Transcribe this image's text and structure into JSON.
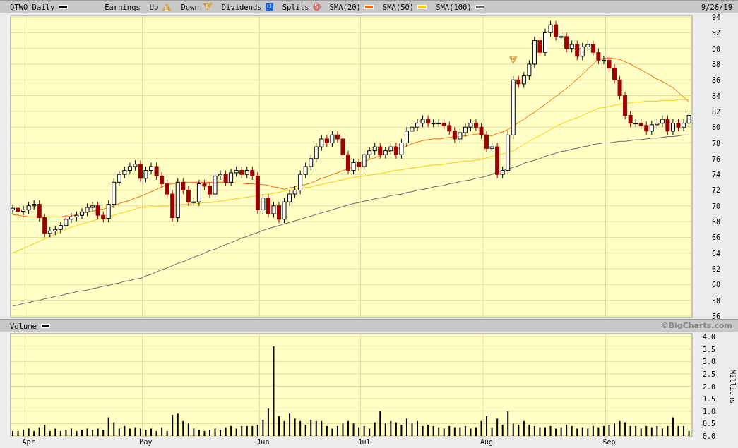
{
  "header": {
    "title": "QTWO Daily",
    "color": "#000000",
    "date": "9/26/19"
  },
  "legend": [
    {
      "kind": "text",
      "label": "Earnings"
    },
    {
      "kind": "earnings-up",
      "label": "Up",
      "glyph": "E"
    },
    {
      "kind": "earnings-down",
      "label": "Down",
      "glyph": "E"
    },
    {
      "kind": "dividend",
      "label": "Dividends",
      "glyph": "D"
    },
    {
      "kind": "split",
      "label": "Splits",
      "glyph": "S"
    }
  ],
  "price_chart": {
    "chart_data": {
      "type": "candlestick",
      "grid": true,
      "ylim": [
        56,
        94
      ],
      "yticks": [
        56,
        58,
        60,
        62,
        64,
        66,
        68,
        70,
        72,
        74,
        76,
        78,
        80,
        82,
        84,
        86,
        88,
        90,
        92,
        94
      ],
      "ohlc": [
        [
          69.5,
          70.2,
          69.0,
          69.7
        ],
        [
          69.7,
          70.2,
          68.8,
          69.3
        ],
        [
          69.3,
          70.0,
          68.8,
          69.5
        ],
        [
          69.5,
          70.5,
          69.0,
          70
        ],
        [
          70,
          70.7,
          69.5,
          70.2
        ],
        [
          70.2,
          70.7,
          68.0,
          68.5
        ],
        [
          68.5,
          69.0,
          66.0,
          66.5
        ],
        [
          66.5,
          67.3,
          66.0,
          66.8
        ],
        [
          66.8,
          67.5,
          66.3,
          67
        ],
        [
          67,
          68.0,
          66.5,
          67.5
        ],
        [
          67.5,
          68.8,
          67.0,
          68.3
        ],
        [
          68.3,
          69.1,
          67.8,
          68.6
        ],
        [
          68.6,
          69.3,
          68.1,
          68.8
        ],
        [
          68.8,
          69.7,
          68.3,
          69.2
        ],
        [
          69.2,
          70.3,
          68.7,
          69.8
        ],
        [
          69.8,
          70.5,
          69.3,
          70
        ],
        [
          70,
          70.5,
          68.3,
          68.8
        ],
        [
          68.8,
          69.3,
          67.9,
          68.4
        ],
        [
          68.4,
          70.7,
          67.9,
          70.2
        ],
        [
          70.2,
          73.5,
          69.7,
          73
        ],
        [
          73,
          74.5,
          72.5,
          74
        ],
        [
          74,
          75.0,
          73.5,
          74.5
        ],
        [
          74.5,
          75.5,
          74.0,
          75
        ],
        [
          75,
          75.8,
          74.5,
          75.3
        ],
        [
          75.3,
          75.8,
          73.0,
          73.5
        ],
        [
          73.5,
          75.0,
          73.0,
          74.5
        ],
        [
          74.5,
          75.5,
          74.0,
          75
        ],
        [
          75,
          75.5,
          73.3,
          73.8
        ],
        [
          73.8,
          74.3,
          72.3,
          72.8
        ],
        [
          72.8,
          73.3,
          71.0,
          71.5
        ],
        [
          71.5,
          72.0,
          68.0,
          68.5
        ],
        [
          68.5,
          73.5,
          68.0,
          73
        ],
        [
          73,
          73.5,
          71.5,
          72
        ],
        [
          72,
          72.5,
          70.0,
          70.5
        ],
        [
          70.5,
          71.0,
          70.0,
          70.5
        ],
        [
          70.5,
          73.3,
          70.0,
          72.8
        ],
        [
          72.8,
          73.3,
          72.0,
          72.5
        ],
        [
          72.5,
          73.0,
          71.0,
          71.5
        ],
        [
          71.5,
          74.3,
          71.0,
          73.8
        ],
        [
          73.8,
          74.5,
          73.3,
          74
        ],
        [
          74,
          74.5,
          72.5,
          73
        ],
        [
          73,
          74.7,
          72.5,
          74.2
        ],
        [
          74.2,
          75.0,
          73.7,
          74.5
        ],
        [
          74.5,
          75.0,
          73.5,
          74
        ],
        [
          74,
          75.0,
          73.5,
          74.5
        ],
        [
          74.5,
          75.0,
          73.3,
          73.8
        ],
        [
          73.8,
          74.3,
          69.0,
          69.5
        ],
        [
          69.5,
          71.5,
          69.0,
          71
        ],
        [
          71,
          71.5,
          68.5,
          69
        ],
        [
          69,
          70.5,
          68.5,
          70
        ],
        [
          70,
          70.5,
          67.8,
          68.3
        ],
        [
          68.3,
          71.0,
          67.8,
          70.5
        ],
        [
          70.5,
          72.0,
          70.0,
          71.5
        ],
        [
          71.5,
          72.5,
          71.0,
          72
        ],
        [
          72,
          74.5,
          71.5,
          74
        ],
        [
          74,
          75.5,
          73.5,
          75
        ],
        [
          75,
          76.5,
          74.5,
          76
        ],
        [
          76,
          78.0,
          75.5,
          77.5
        ],
        [
          77.5,
          79.0,
          77.0,
          78.5
        ],
        [
          78.5,
          79.0,
          77.5,
          78
        ],
        [
          78,
          79.5,
          77.5,
          79
        ],
        [
          79,
          79.5,
          78.0,
          78.5
        ],
        [
          78.5,
          79.0,
          76.0,
          76.5
        ],
        [
          76.5,
          77.0,
          74.0,
          74.5
        ],
        [
          74.5,
          76.0,
          74.0,
          75.5
        ],
        [
          75.5,
          76.0,
          74.5,
          75
        ],
        [
          75,
          77.0,
          74.5,
          76.5
        ],
        [
          76.5,
          77.5,
          76.0,
          77
        ],
        [
          77,
          78.0,
          76.5,
          77.5
        ],
        [
          77.5,
          78.0,
          76.0,
          76.5
        ],
        [
          76.5,
          77.5,
          76.0,
          77
        ],
        [
          77,
          78.0,
          76.5,
          77.5
        ],
        [
          77.5,
          78.0,
          76.0,
          76.5
        ],
        [
          76.5,
          78.5,
          76.0,
          78
        ],
        [
          78,
          80.0,
          77.5,
          79.5
        ],
        [
          79.5,
          80.5,
          79.0,
          80
        ],
        [
          80,
          81.0,
          79.5,
          80.5
        ],
        [
          80.5,
          81.5,
          80.0,
          81
        ],
        [
          81,
          81.5,
          80.0,
          80.5
        ],
        [
          80.5,
          81.0,
          80.0,
          80.5
        ],
        [
          80.5,
          81.0,
          80.0,
          80.5
        ],
        [
          80.5,
          81.0,
          79.7,
          80.2
        ],
        [
          80.2,
          80.7,
          79.0,
          79.5
        ],
        [
          79.5,
          80.0,
          78.0,
          78.5
        ],
        [
          78.5,
          79.8,
          78.0,
          79.3
        ],
        [
          79.3,
          80.5,
          78.8,
          80
        ],
        [
          80,
          81.0,
          79.5,
          80.5
        ],
        [
          80.5,
          81.0,
          79.5,
          80
        ],
        [
          80,
          80.5,
          78.5,
          79
        ],
        [
          79,
          79.5,
          76.8,
          77.3
        ],
        [
          77.3,
          78.0,
          76.8,
          77.5
        ],
        [
          77.5,
          78.0,
          73.5,
          74
        ],
        [
          74,
          75.0,
          73.5,
          74.5
        ],
        [
          74.5,
          79.5,
          74.0,
          79
        ],
        [
          79,
          86.5,
          78.5,
          86
        ],
        [
          86,
          86.5,
          85.0,
          85.5
        ],
        [
          85.5,
          87.0,
          85.0,
          86.5
        ],
        [
          86.5,
          88.5,
          86.0,
          88
        ],
        [
          88,
          91.5,
          87.5,
          91
        ],
        [
          91,
          91.5,
          89.0,
          89.5
        ],
        [
          89.5,
          92.5,
          89.0,
          92
        ],
        [
          92,
          93.5,
          91.5,
          93
        ],
        [
          93,
          93.5,
          91.0,
          91.5
        ],
        [
          91.5,
          92.0,
          91.0,
          91.5
        ],
        [
          91.5,
          92.0,
          89.5,
          90
        ],
        [
          90,
          91.0,
          89.5,
          90.5
        ],
        [
          90.5,
          91.0,
          88.5,
          89
        ],
        [
          89,
          90.7,
          88.5,
          90.2
        ],
        [
          90.2,
          91.0,
          89.7,
          90.5
        ],
        [
          90.5,
          91.0,
          89.0,
          89.5
        ],
        [
          89.5,
          90.0,
          88.0,
          88.5
        ],
        [
          88.5,
          89.0,
          88.0,
          88.5
        ],
        [
          88.5,
          89.0,
          87.0,
          87.5
        ],
        [
          87.5,
          88.0,
          85.5,
          86
        ],
        [
          86,
          86.5,
          83.5,
          84
        ],
        [
          84,
          84.5,
          81.0,
          81.5
        ],
        [
          81.5,
          82.0,
          80.0,
          80.5
        ],
        [
          80.5,
          81.0,
          80.0,
          80.5
        ],
        [
          80.5,
          81.0,
          79.7,
          80.2
        ],
        [
          80.2,
          80.7,
          79.0,
          79.5
        ],
        [
          79.5,
          80.8,
          79.0,
          80.3
        ],
        [
          80.3,
          81.0,
          79.8,
          80.5
        ],
        [
          80.5,
          81.5,
          80.0,
          81
        ],
        [
          81,
          81.5,
          79.0,
          79.5
        ],
        [
          79.5,
          81.0,
          79.0,
          80.5
        ],
        [
          80.5,
          81.0,
          79.5,
          80
        ],
        [
          80,
          81.0,
          79.5,
          80.5
        ],
        [
          80.5,
          82.0,
          80.0,
          81.5
        ]
      ]
    },
    "events": [
      {
        "kind": "earnings-down",
        "glyph": "E"
      }
    ],
    "averages": {
      "chart_data": {
        "type": "line",
        "ylim": [
          56,
          94
        ],
        "series": [
          {
            "name": "SMA(20)",
            "color": "#ff6600",
            "values": [
              68.9,
              68.8,
              68.7,
              68.6,
              68.6,
              68.6,
              68.6,
              68.6,
              68.6,
              68.6,
              68.7,
              68.7,
              68.9,
              69.0,
              69.2,
              69.3,
              69.5,
              69.6,
              69.8,
              70.0,
              70.3,
              70.5,
              70.7,
              71.0,
              71.2,
              71.5,
              71.8,
              72.1,
              72.4,
              72.7,
              72.8,
              72.9,
              73.0,
              73.0,
              73.0,
              73.0,
              73.0,
              73.0,
              73.0,
              73.0,
              73.0,
              73.0,
              72.9,
              72.9,
              72.8,
              72.8,
              72.7,
              72.7,
              72.6,
              72.4,
              72.3,
              72.1,
              72.3,
              72.4,
              72.6,
              72.7,
              72.9,
              73.2,
              73.5,
              73.7,
              74.0,
              74.2,
              74.5,
              74.7,
              75.0,
              75.3,
              75.6,
              75.9,
              76.1,
              76.4,
              76.7,
              77.0,
              77.2,
              77.4,
              77.6,
              77.9,
              78.1,
              78.3,
              78.4,
              78.5,
              78.5,
              78.6,
              78.7,
              78.8,
              78.8,
              78.9,
              79.0,
              79.1,
              79.2,
              79.0,
              78.9,
              79.2,
              79.4,
              79.7,
              80.1,
              80.6,
              81.0,
              81.5,
              81.9,
              82.4,
              82.9,
              83.4,
              83.9,
              84.4,
              84.9,
              85.5,
              86.1,
              86.7,
              87.4,
              88.0,
              88.6,
              88.7,
              88.8,
              88.7,
              88.6,
              88.3,
              88.0,
              87.6,
              87.3,
              86.9,
              86.5,
              86.1,
              85.8,
              85.4,
              85.0,
              84.4,
              83.8,
              83.2
            ]
          },
          {
            "name": "SMA(50)",
            "color": "#ffcc00",
            "values": [
              64.0,
              64.3,
              64.6,
              64.9,
              65.2,
              65.5,
              65.8,
              66.1,
              66.4,
              66.7,
              67.0,
              67.3,
              67.5,
              67.7,
              67.9,
              68.1,
              68.3,
              68.4,
              68.6,
              68.8,
              69.0,
              69.2,
              69.4,
              69.6,
              69.8,
              69.8,
              69.9,
              69.9,
              70.0,
              70.0,
              70.1,
              70.1,
              70.2,
              70.2,
              70.3,
              70.3,
              70.4,
              70.4,
              70.5,
              70.6,
              70.7,
              70.8,
              70.9,
              71.0,
              71.1,
              71.2,
              71.3,
              71.4,
              71.5,
              71.6,
              71.7,
              71.9,
              72.0,
              72.1,
              72.2,
              72.3,
              72.4,
              72.6,
              72.7,
              72.9,
              73.0,
              73.2,
              73.3,
              73.5,
              73.6,
              73.7,
              73.8,
              73.9,
              74.0,
              74.1,
              74.2,
              74.4,
              74.5,
              74.6,
              74.7,
              74.8,
              74.9,
              75.0,
              75.1,
              75.2,
              75.2,
              75.3,
              75.4,
              75.5,
              75.6,
              75.7,
              75.7,
              75.8,
              75.9,
              76.1,
              76.3,
              76.4,
              76.6,
              76.8,
              77.0,
              77.4,
              77.8,
              78.2,
              78.6,
              78.9,
              79.3,
              79.7,
              80.1,
              80.4,
              80.7,
              81.0,
              81.2,
              81.5,
              81.8,
              82.1,
              82.4,
              82.5,
              82.6,
              82.8,
              82.9,
              83.0,
              83.1,
              83.2,
              83.2,
              83.3,
              83.3,
              83.3,
              83.4,
              83.4,
              83.4,
              83.5,
              83.5,
              83.5
            ]
          },
          {
            "name": "SMA(100)",
            "color": "#666666",
            "values": [
              57.3,
              57.4,
              57.6,
              57.7,
              57.9,
              58.0,
              58.2,
              58.3,
              58.5,
              58.6,
              58.8,
              58.9,
              59.1,
              59.2,
              59.3,
              59.5,
              59.6,
              59.8,
              59.9,
              60.1,
              60.2,
              60.4,
              60.5,
              60.7,
              60.8,
              61.1,
              61.3,
              61.6,
              61.9,
              62.1,
              62.4,
              62.7,
              62.9,
              63.2,
              63.5,
              63.7,
              64.0,
              64.3,
              64.5,
              64.8,
              65.1,
              65.3,
              65.6,
              65.9,
              66.1,
              66.4,
              66.6,
              66.9,
              67.1,
              67.3,
              67.5,
              67.7,
              67.9,
              68.1,
              68.3,
              68.5,
              68.7,
              68.9,
              69.1,
              69.3,
              69.5,
              69.7,
              69.9,
              70.1,
              70.3,
              70.4,
              70.6,
              70.7,
              70.9,
              71.0,
              71.1,
              71.3,
              71.4,
              71.5,
              71.7,
              71.8,
              72.0,
              72.1,
              72.2,
              72.4,
              72.5,
              72.6,
              72.8,
              72.9,
              73.1,
              73.2,
              73.3,
              73.5,
              73.6,
              73.8,
              74.0,
              74.3,
              74.5,
              74.7,
              74.9,
              75.1,
              75.4,
              75.6,
              75.8,
              76.0,
              76.3,
              76.5,
              76.7,
              76.9,
              77.0,
              77.2,
              77.3,
              77.5,
              77.6,
              77.8,
              77.9,
              78.0,
              78.0,
              78.1,
              78.2,
              78.2,
              78.3,
              78.4,
              78.4,
              78.5,
              78.6,
              78.6,
              78.7,
              78.8,
              78.8,
              78.9,
              79.0,
              79.0
            ]
          }
        ]
      }
    }
  },
  "volume_panel": {
    "credit": "©BigCharts.com",
    "chart_data": {
      "type": "bar",
      "grid": true,
      "ylabel": "Millions",
      "ylim": [
        0,
        4
      ],
      "yticks": [
        {
          "value": 0,
          "label": "0.0"
        },
        {
          "value": 0.5,
          "label": "0.5"
        },
        {
          "value": 1,
          "label": "1.0"
        },
        {
          "value": 1.5,
          "label": "1.5"
        },
        {
          "value": 2,
          "label": "2.0"
        },
        {
          "value": 2.5,
          "label": "2.5"
        },
        {
          "value": 3,
          "label": "3.0"
        },
        {
          "value": 3.5,
          "label": "3.5"
        },
        {
          "value": 4,
          "label": "4.0"
        }
      ],
      "categories": [
        null,
        null,
        null,
        "Apr",
        null,
        null,
        null,
        null,
        null,
        null,
        null,
        null,
        null,
        null,
        null,
        null,
        null,
        null,
        null,
        null,
        null,
        null,
        null,
        null,
        null,
        "May",
        null,
        null,
        null,
        null,
        null,
        null,
        null,
        null,
        null,
        null,
        null,
        null,
        null,
        null,
        null,
        null,
        null,
        null,
        null,
        null,
        null,
        "Jun",
        null,
        null,
        null,
        null,
        null,
        null,
        null,
        null,
        null,
        null,
        null,
        null,
        null,
        null,
        null,
        null,
        null,
        null,
        "Jul",
        null,
        null,
        null,
        null,
        null,
        null,
        null,
        null,
        null,
        null,
        null,
        null,
        null,
        null,
        null,
        null,
        null,
        null,
        null,
        null,
        null,
        null,
        "Aug",
        null,
        null,
        null,
        null,
        null,
        null,
        null,
        null,
        null,
        null,
        null,
        null,
        null,
        null,
        null,
        null,
        null,
        null,
        null,
        null,
        null,
        null,
        "Sep",
        null,
        null,
        null,
        null,
        null,
        null,
        null,
        null,
        null,
        null,
        null,
        null,
        null,
        null,
        null
      ],
      "series": [
        {
          "name": "Volume",
          "color": "#000000",
          "values": [
            0.2,
            0.2,
            0.25,
            0.3,
            0.2,
            0.35,
            0.45,
            0.2,
            0.3,
            0.2,
            0.25,
            0.3,
            0.2,
            0.25,
            0.3,
            0.25,
            0.3,
            0.25,
            0.75,
            0.55,
            0.3,
            0.4,
            0.3,
            0.35,
            0.3,
            0.25,
            0.3,
            0.2,
            0.35,
            0.2,
            0.85,
            0.9,
            0.6,
            0.5,
            0.3,
            0.25,
            0.2,
            0.25,
            0.3,
            0.25,
            0.35,
            0.4,
            0.3,
            0.4,
            0.4,
            0.4,
            0.45,
            0.65,
            1.1,
            3.6,
            0.8,
            0.6,
            0.9,
            0.7,
            0.6,
            0.45,
            0.65,
            0.6,
            0.6,
            0.4,
            0.3,
            0.4,
            0.5,
            0.6,
            0.5,
            0.35,
            0.4,
            0.3,
            0.55,
            1.0,
            0.5,
            0.6,
            0.55,
            0.45,
            0.7,
            0.5,
            0.6,
            0.4,
            0.45,
            0.4,
            0.35,
            0.3,
            0.4,
            0.35,
            0.35,
            0.4,
            0.3,
            0.35,
            0.6,
            0.8,
            0.35,
            0.7,
            0.45,
            1.0,
            0.5,
            0.45,
            0.6,
            0.45,
            0.4,
            0.35,
            0.35,
            0.4,
            0.3,
            0.35,
            0.45,
            0.4,
            0.3,
            0.35,
            0.3,
            0.4,
            0.35,
            0.4,
            0.45,
            0.5,
            0.6,
            0.55,
            0.4,
            0.4,
            0.3,
            0.4,
            0.35,
            0.4,
            0.3,
            0.4,
            0.75,
            0.4,
            0.4,
            0.2
          ]
        }
      ]
    }
  }
}
